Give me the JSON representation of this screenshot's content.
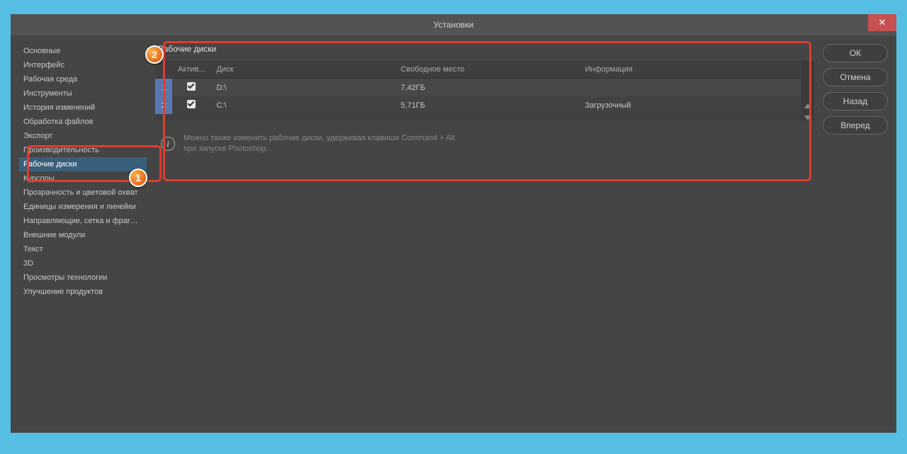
{
  "title": "Установки",
  "close_label": "✕",
  "sidebar": {
    "items": [
      {
        "label": "Основные"
      },
      {
        "label": "Интерфейс"
      },
      {
        "label": "Рабочая среда"
      },
      {
        "label": "Инструменты"
      },
      {
        "label": "История изменений"
      },
      {
        "label": "Обработка файлов"
      },
      {
        "label": "Экспорт"
      },
      {
        "label": "Производительность"
      },
      {
        "label": "Рабочие диски"
      },
      {
        "label": "Курсоры"
      },
      {
        "label": "Прозрачность и цветовой охват"
      },
      {
        "label": "Единицы измерения и линейки"
      },
      {
        "label": "Направляющие, сетка и фрагменты"
      },
      {
        "label": "Внешние модули"
      },
      {
        "label": "Текст"
      },
      {
        "label": "3D"
      },
      {
        "label": "Просмотры технологии"
      },
      {
        "label": "Улучшение продуктов"
      }
    ],
    "selected_index": 8
  },
  "panel": {
    "title": "Рабочие диски",
    "columns": {
      "active": "Актив...",
      "disk": "Диск",
      "free": "Свободное место",
      "info": "Информация"
    },
    "rows": [
      {
        "num": "1",
        "checked": true,
        "disk": "D:\\",
        "free": "7,42ГБ",
        "info": ""
      },
      {
        "num": "2",
        "checked": true,
        "disk": "C:\\",
        "free": "5,71ГБ",
        "info": "Загрузочный"
      }
    ]
  },
  "info": {
    "line1": "Можно также изменить рабочие диски, удерживая клавиши Command + Alt",
    "line2": "при запуске Photoshop."
  },
  "buttons": {
    "ok": "ОК",
    "cancel": "Отмена",
    "prev": "Назад",
    "next": "Вперед"
  },
  "markers": {
    "m1": "1",
    "m2": "2"
  }
}
